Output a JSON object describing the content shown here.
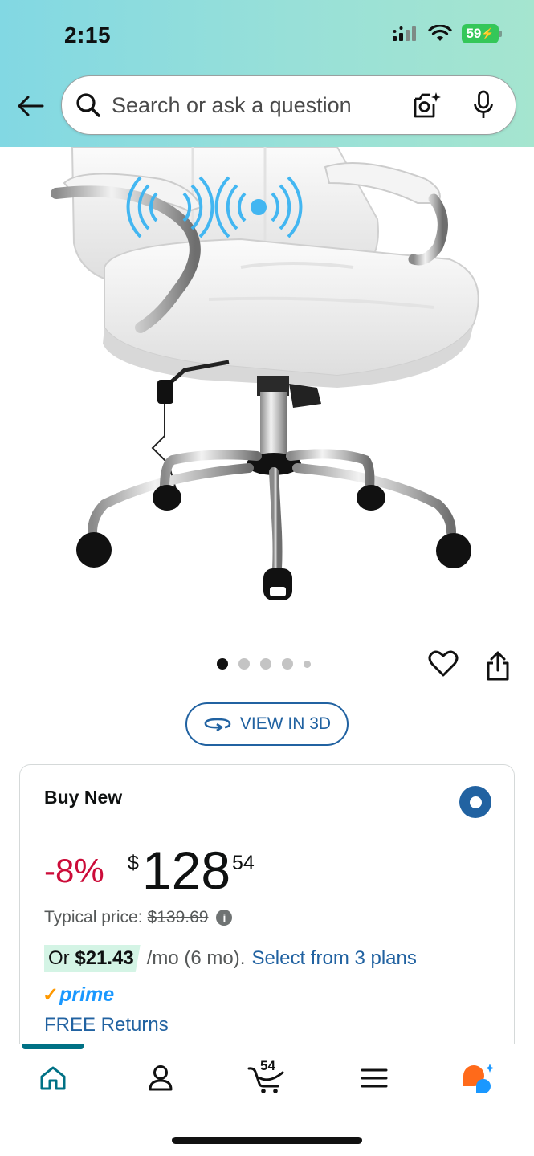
{
  "status_bar": {
    "time": "2:15",
    "battery": "59"
  },
  "search": {
    "placeholder": "Search or ask a question"
  },
  "carousel": {
    "dots": 5,
    "active_index": 0
  },
  "view_3d": {
    "label": "VIEW IN 3D"
  },
  "buy_box": {
    "title": "Buy New",
    "discount": "-8%",
    "price_symbol": "$",
    "price_whole": "128",
    "price_fraction": "54",
    "typical_label": "Typical price:",
    "typical_value": "$139.69",
    "installment_prefix": "Or",
    "installment_amount": "$21.43",
    "installment_rest": "/mo (6 mo).",
    "plans_link": "Select from 3 plans",
    "prime_label": "prime",
    "free_returns": "FREE Returns"
  },
  "bottom_nav": {
    "cart_count": "54",
    "items": [
      "home-icon",
      "account-icon",
      "cart-icon",
      "menu-icon",
      "rufus-icon"
    ]
  },
  "colors": {
    "accent": "#2162a1",
    "discount": "#cc0c39",
    "prime": "#1a98ff",
    "nav_active": "#007185"
  }
}
